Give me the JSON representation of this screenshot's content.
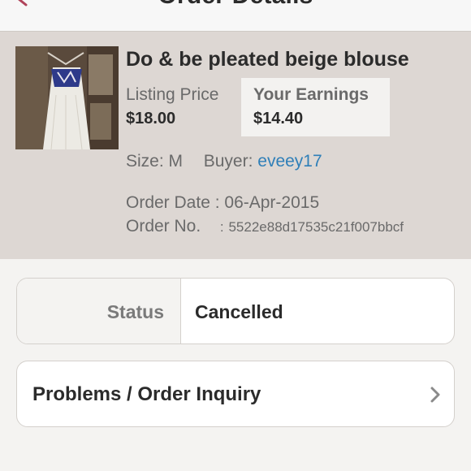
{
  "header": {
    "title": "Order Details"
  },
  "item": {
    "title": "Do & be pleated beige blouse",
    "listing_price_label": "Listing Price",
    "listing_price": "$18.00",
    "earnings_label": "Your Earnings",
    "earnings": "$14.40",
    "size_label": "Size:",
    "size": "M",
    "buyer_label": "Buyer:",
    "buyer": "eveey17",
    "order_date_label": "Order Date :",
    "order_date": "06-Apr-2015",
    "order_no_label": "Order No.",
    "order_no_sep": ":",
    "order_no": "5522e88d17535c21f007bbcf"
  },
  "status": {
    "label": "Status",
    "value": "Cancelled"
  },
  "inquiry": {
    "label": "Problems / Order Inquiry"
  },
  "colors": {
    "accent": "#b0435a",
    "buyer_link": "#2f7fb8",
    "panel_bg": "#ddd7d3"
  }
}
